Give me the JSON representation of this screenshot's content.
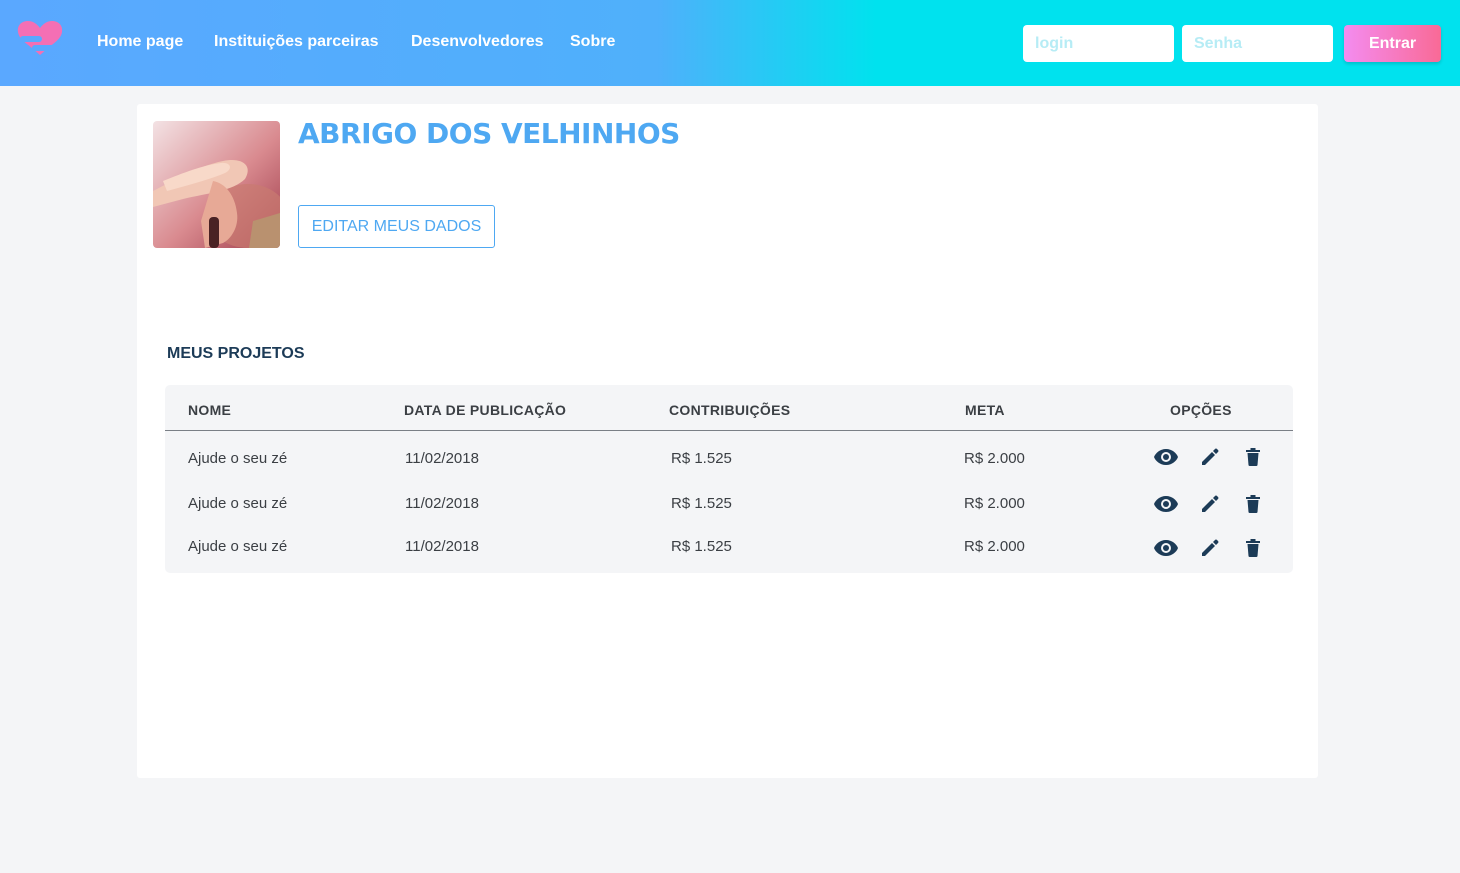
{
  "header": {
    "nav": [
      {
        "label": "Home page"
      },
      {
        "label": "Instituições parceiras"
      },
      {
        "label": "Desenvolvedores"
      },
      {
        "label": "Sobre"
      }
    ],
    "login_placeholder": "login",
    "password_placeholder": "Senha",
    "enter_label": "Entrar"
  },
  "profile": {
    "name": "ABRIGO DOS VELHINHOS",
    "edit_label": "EDITAR MEUS DADOS"
  },
  "projects": {
    "title": "MEUS PROJETOS",
    "columns": [
      "NOME",
      "DATA DE PUBLICAÇÃO",
      "CONTRIBUIÇÕES",
      "META",
      "OPÇÕES"
    ],
    "rows": [
      {
        "name": "Ajude o seu zé",
        "date": "11/02/2018",
        "contributions": "R$ 1.525",
        "goal": "R$ 2.000"
      },
      {
        "name": "Ajude o seu zé",
        "date": "11/02/2018",
        "contributions": "R$ 1.525",
        "goal": "R$ 2.000"
      },
      {
        "name": "Ajude o seu zé",
        "date": "11/02/2018",
        "contributions": "R$ 1.525",
        "goal": "R$ 2.000"
      }
    ]
  },
  "icons": {
    "logo": "heart-logo-icon",
    "view": "eye-icon",
    "edit": "pencil-icon",
    "delete": "trash-icon"
  },
  "colors": {
    "brand_blue": "#4ea8f2",
    "header_cyan": "#00e2ee",
    "accent_pink": "#f96a96",
    "icon_dark": "#1c3b57"
  }
}
